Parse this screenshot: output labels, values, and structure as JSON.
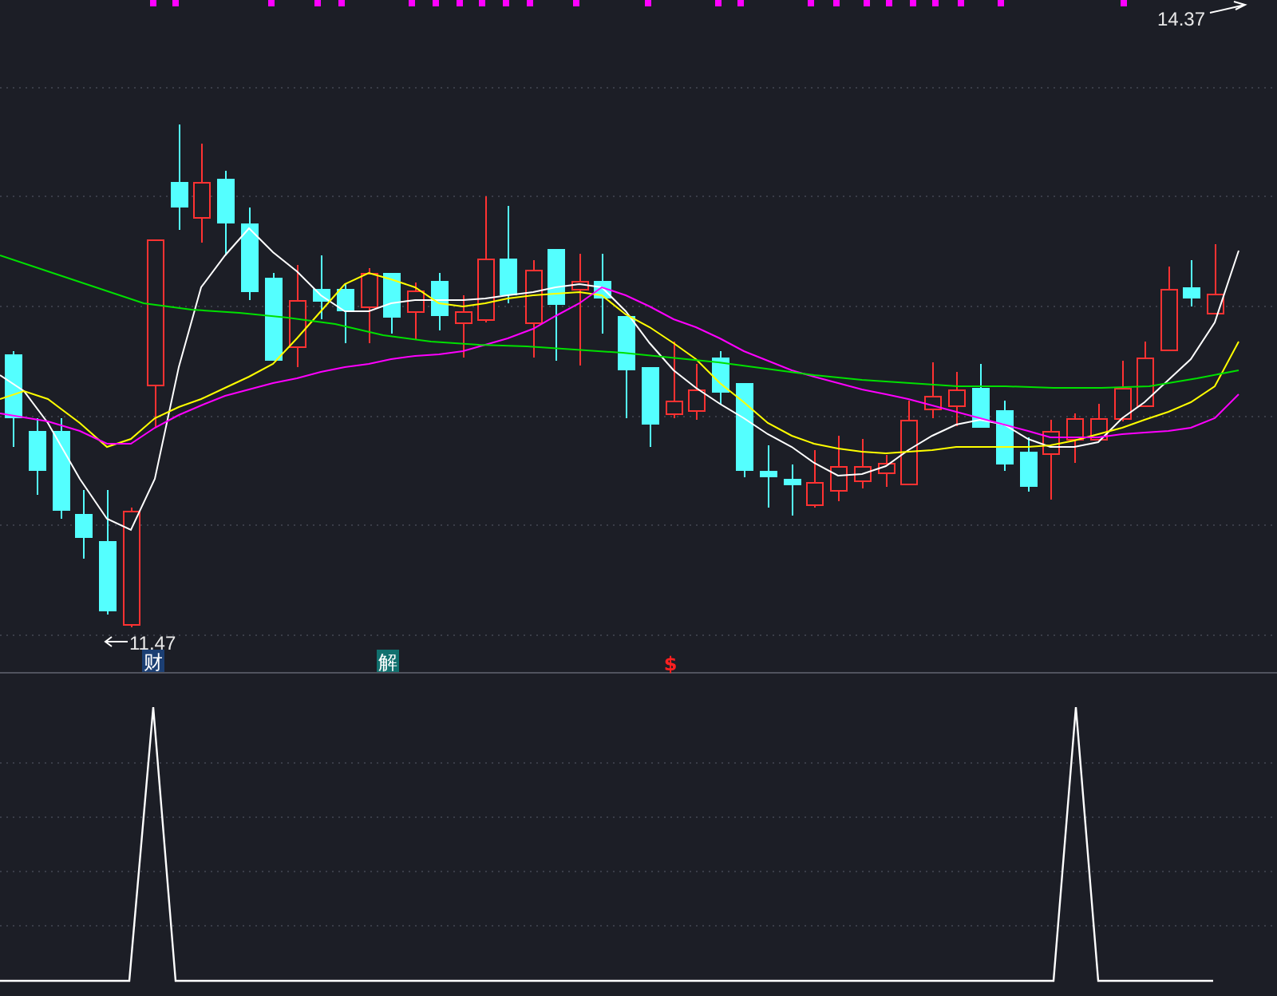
{
  "price_chart": {
    "high_label": "14.37",
    "low_label": "11.47",
    "markers": [
      {
        "kind": "badge",
        "text": "财",
        "color": "#1c3f73"
      },
      {
        "kind": "badge",
        "text": "解",
        "color": "#11706e"
      },
      {
        "kind": "plain",
        "text": "$",
        "color": "#ff2020"
      }
    ]
  }
}
